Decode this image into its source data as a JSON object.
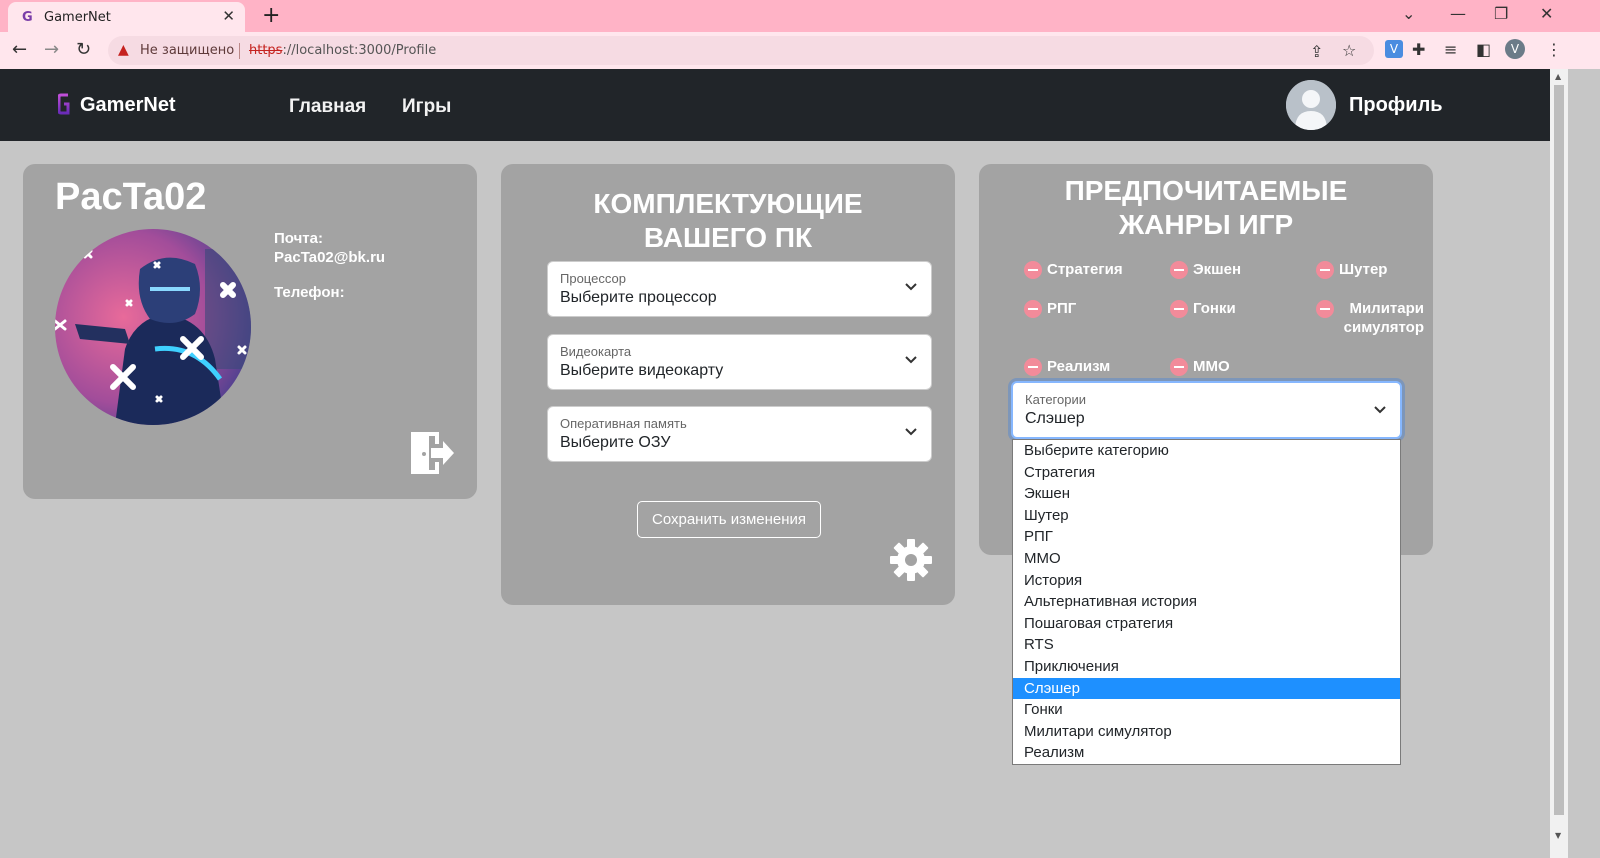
{
  "browser": {
    "tab_title": "GamerNet",
    "new_tab_glyph": "+",
    "security_text": "Не защищено",
    "url_scheme": "https",
    "url_rest": "://localhost:3000/Profile",
    "profile_initial": "V",
    "extension_initial": "V"
  },
  "navbar": {
    "brand": "GamerNet",
    "links": [
      "Главная",
      "Игры"
    ],
    "profile": "Профиль"
  },
  "profile_card": {
    "username": "PacTa02",
    "email_label": "Почта:",
    "email_value": "PacTa02@bk.ru",
    "phone_label": "Телефон:"
  },
  "pc_card": {
    "title": "КОМПЛЕКТУЮЩИЕ ВАШЕГО ПК",
    "selects": [
      {
        "label": "Процессор",
        "value": "Выберите процессор"
      },
      {
        "label": "Видеокарта",
        "value": "Выберите видеокарту"
      },
      {
        "label": "Оперативная память",
        "value": "Выберите ОЗУ"
      }
    ],
    "save_label": "Сохранить изменения"
  },
  "genres_card": {
    "title": "ПРЕДПОЧИТАЕМЫЕ ЖАНРЫ ИГР",
    "genres": [
      "Стратегия",
      "Экшен",
      "Шутер",
      "РПГ",
      "Гонки",
      "Милитари симулятор",
      "Реализм",
      "MMO"
    ],
    "category_select": {
      "label": "Категории",
      "value": "Слэшер",
      "options": [
        "Выберите категорию",
        "Стратегия",
        "Экшен",
        "Шутер",
        "РПГ",
        "MMO",
        "История",
        "Альтернативная история",
        "Пошаговая стратегия",
        "RTS",
        "Приключения",
        "Слэшер",
        "Гонки",
        "Милитари симулятор",
        "Реализм"
      ],
      "selected_index": 11
    }
  },
  "colors": {
    "navbar_bg": "#212529",
    "card_bg": "#a3a3a3",
    "page_bg": "#c6c6c6",
    "tab_bar": "#ffb3c6",
    "selected_option": "#1e90ff",
    "remove_genre": "#f28b9a"
  }
}
